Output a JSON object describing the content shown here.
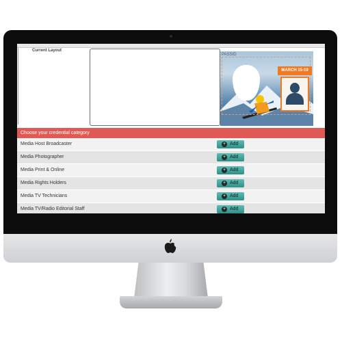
{
  "layout": {
    "title": "Current Layout"
  },
  "card": {
    "label": "PASSID",
    "banner": "MARCH 15-19"
  },
  "categories": {
    "header": "Choose your credential category",
    "items": [
      {
        "label": "Media Host Broadcaster",
        "button": "Add"
      },
      {
        "label": "Media Photographer",
        "button": "Add"
      },
      {
        "label": "Media Print & Online",
        "button": "Add"
      },
      {
        "label": "Media Rights Holders",
        "button": "Add"
      },
      {
        "label": "Media TV Technicians",
        "button": "Add"
      },
      {
        "label": "Media TV/Radio Editorial Staff",
        "button": "Add"
      }
    ]
  },
  "colors": {
    "header": "#e05a55",
    "button": "#3aa39a",
    "accent": "#f07a24"
  },
  "icons": {
    "apple": "apple-logo-icon",
    "add": "plus-circle-icon",
    "placeholder": "person-silhouette-icon"
  }
}
